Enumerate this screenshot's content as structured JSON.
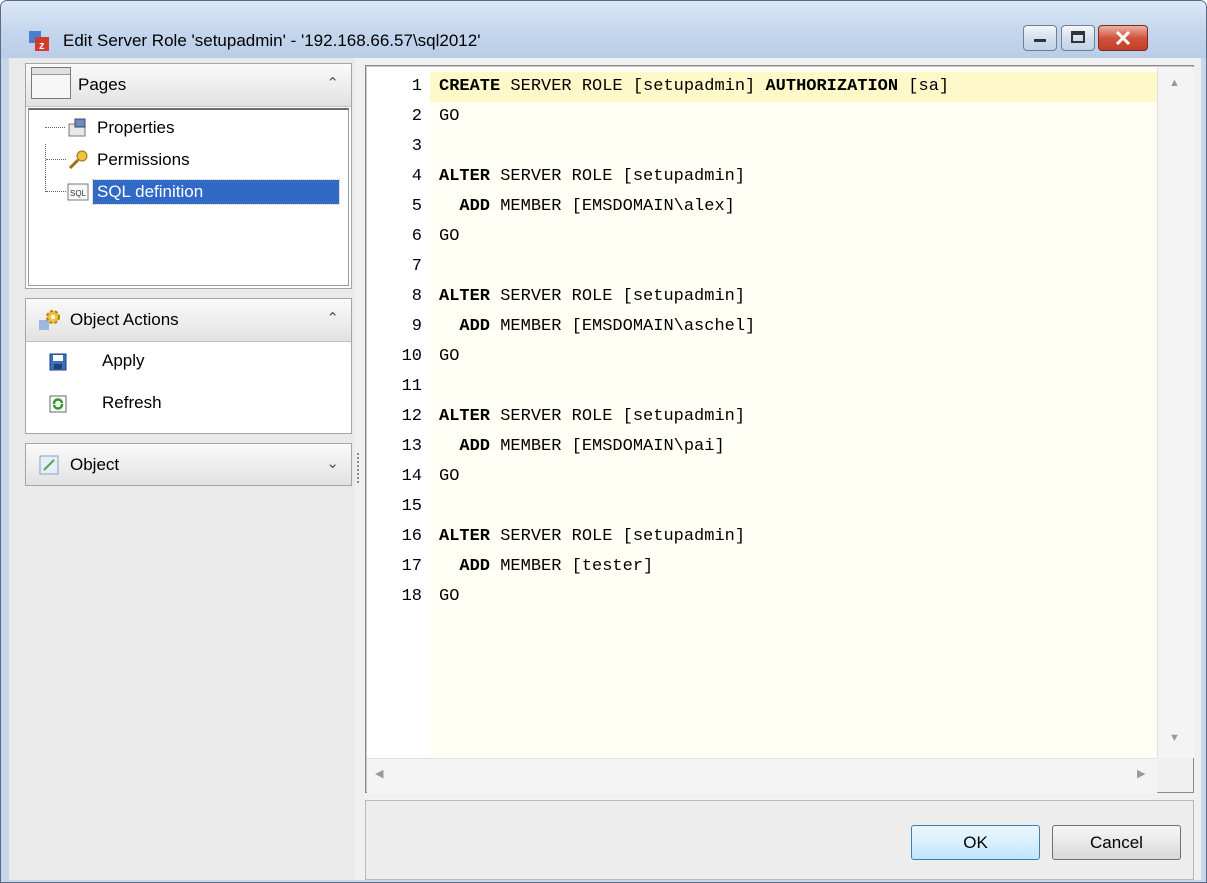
{
  "window": {
    "title": "Edit Server Role 'setupadmin' - '192.168.66.57\\sql2012'"
  },
  "pages_panel": {
    "title": "Pages",
    "items": [
      {
        "label": "Properties",
        "icon": "properties-icon"
      },
      {
        "label": "Permissions",
        "icon": "key-icon"
      },
      {
        "label": "SQL definition",
        "icon": "sql-icon",
        "selected": true
      }
    ]
  },
  "actions_panel": {
    "title": "Object Actions",
    "items": [
      {
        "label": "Apply",
        "icon": "save-icon"
      },
      {
        "label": "Refresh",
        "icon": "refresh-icon"
      }
    ]
  },
  "object_panel": {
    "title": "Object"
  },
  "editor": {
    "lines": [
      {
        "n": "1",
        "segs": [
          [
            "kw",
            "CREATE"
          ],
          [
            "t",
            " SERVER ROLE [setupadmin] "
          ],
          [
            "kw",
            "AUTHORIZATION"
          ],
          [
            "t",
            " [sa]"
          ]
        ]
      },
      {
        "n": "2",
        "segs": [
          [
            "t",
            "GO"
          ]
        ]
      },
      {
        "n": "3",
        "segs": []
      },
      {
        "n": "4",
        "segs": [
          [
            "kw",
            "ALTER"
          ],
          [
            "t",
            " SERVER ROLE [setupadmin]"
          ]
        ]
      },
      {
        "n": "5",
        "segs": [
          [
            "t",
            "  "
          ],
          [
            "kw",
            "ADD"
          ],
          [
            "t",
            " MEMBER [EMSDOMAIN\\alex]"
          ]
        ]
      },
      {
        "n": "6",
        "segs": [
          [
            "t",
            "GO"
          ]
        ]
      },
      {
        "n": "7",
        "segs": []
      },
      {
        "n": "8",
        "segs": [
          [
            "kw",
            "ALTER"
          ],
          [
            "t",
            " SERVER ROLE [setupadmin]"
          ]
        ]
      },
      {
        "n": "9",
        "segs": [
          [
            "t",
            "  "
          ],
          [
            "kw",
            "ADD"
          ],
          [
            "t",
            " MEMBER [EMSDOMAIN\\aschel]"
          ]
        ]
      },
      {
        "n": "10",
        "segs": [
          [
            "t",
            "GO"
          ]
        ]
      },
      {
        "n": "11",
        "segs": []
      },
      {
        "n": "12",
        "segs": [
          [
            "kw",
            "ALTER"
          ],
          [
            "t",
            " SERVER ROLE [setupadmin]"
          ]
        ]
      },
      {
        "n": "13",
        "segs": [
          [
            "t",
            "  "
          ],
          [
            "kw",
            "ADD"
          ],
          [
            "t",
            " MEMBER [EMSDOMAIN\\pai]"
          ]
        ]
      },
      {
        "n": "14",
        "segs": [
          [
            "t",
            "GO"
          ]
        ]
      },
      {
        "n": "15",
        "segs": []
      },
      {
        "n": "16",
        "segs": [
          [
            "kw",
            "ALTER"
          ],
          [
            "t",
            " SERVER ROLE [setupadmin]"
          ]
        ]
      },
      {
        "n": "17",
        "segs": [
          [
            "t",
            "  "
          ],
          [
            "kw",
            "ADD"
          ],
          [
            "t",
            " MEMBER [tester]"
          ]
        ]
      },
      {
        "n": "18",
        "segs": [
          [
            "t",
            "GO"
          ]
        ]
      }
    ]
  },
  "buttons": {
    "ok": "OK",
    "cancel": "Cancel"
  }
}
